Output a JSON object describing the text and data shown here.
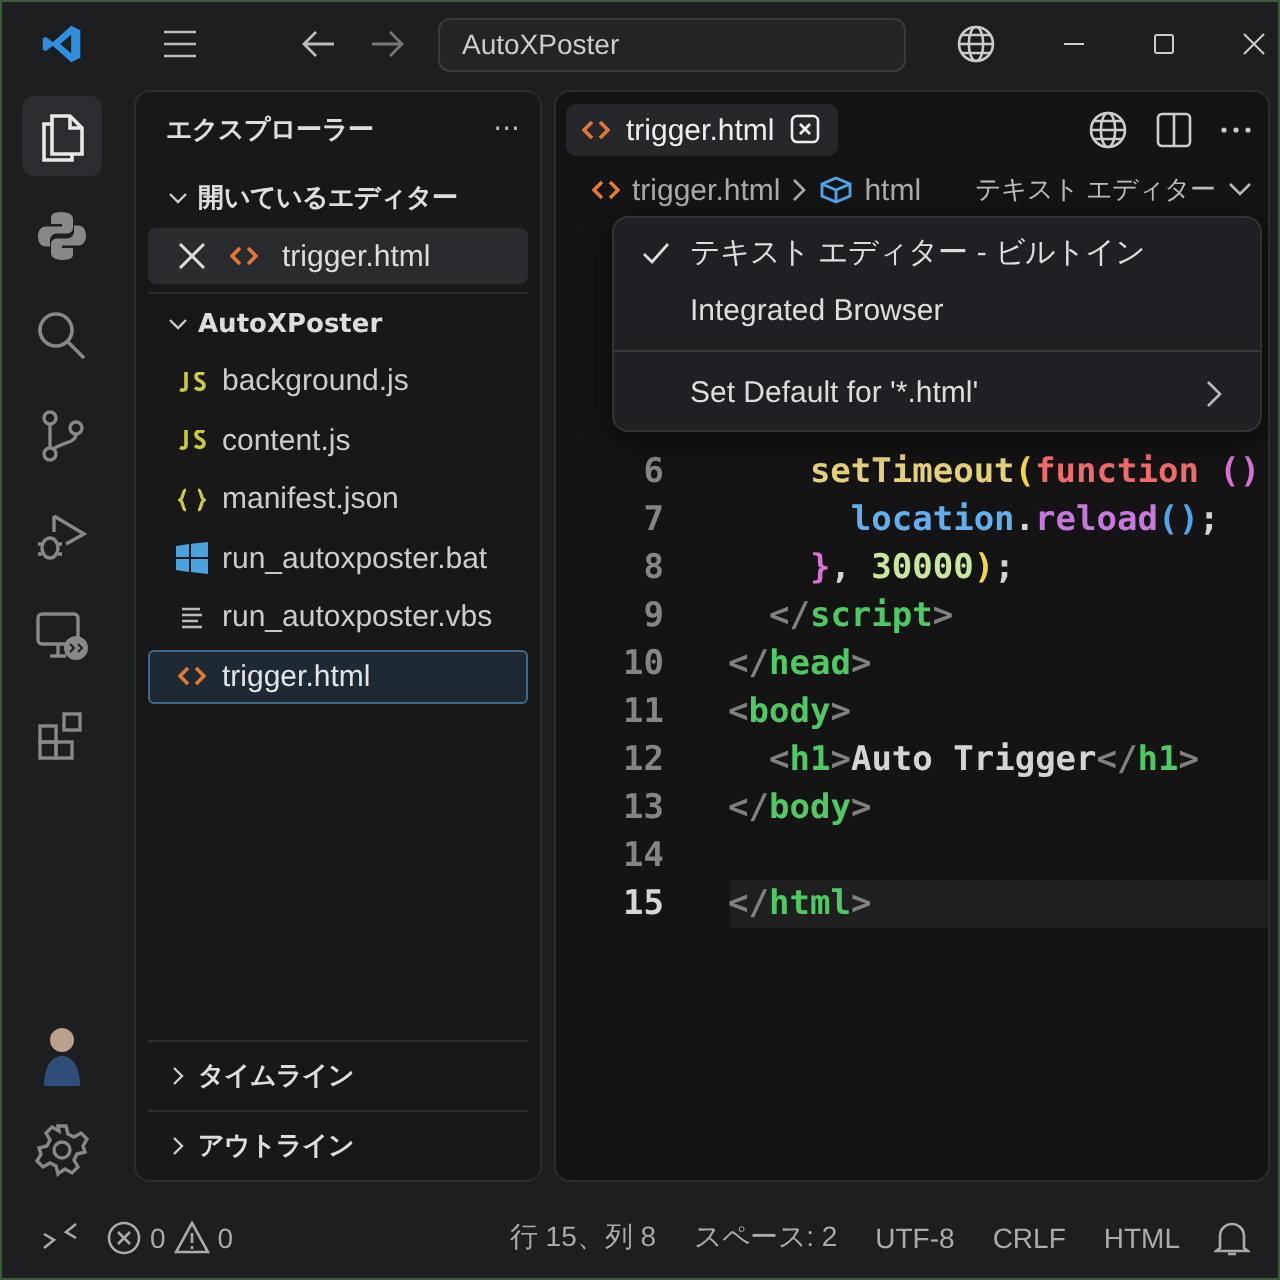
{
  "title_bar": {
    "search": {
      "value": "AutoXPoster"
    }
  },
  "activity_bar": {
    "items": [
      {
        "kind": "files",
        "selected": true
      },
      {
        "kind": "python",
        "selected": false
      },
      {
        "kind": "search",
        "selected": false
      },
      {
        "kind": "branch",
        "selected": false
      },
      {
        "kind": "debug",
        "selected": false
      },
      {
        "kind": "remote",
        "selected": false
      },
      {
        "kind": "extensions",
        "selected": false
      }
    ]
  },
  "sidebar": {
    "title": "エクスプローラー",
    "more": "···",
    "open_editors": {
      "title": "開いているエディター",
      "expanded": true,
      "items": [
        {
          "name": "trigger.html",
          "kind": "html",
          "selected": true
        }
      ]
    },
    "folder": {
      "title": "AutoXPoster",
      "expanded": true,
      "items": [
        {
          "name": "background.js",
          "kind": "js",
          "selected": false
        },
        {
          "name": "content.js",
          "kind": "js",
          "selected": false
        },
        {
          "name": "manifest.json",
          "kind": "json",
          "selected": false
        },
        {
          "name": "run_autoxposter.bat",
          "kind": "bat",
          "selected": false
        },
        {
          "name": "run_autoxposter.vbs",
          "kind": "vbs",
          "selected": false
        },
        {
          "name": "trigger.html",
          "kind": "html",
          "selected": true
        }
      ]
    },
    "sections": [
      {
        "title": "タイムライン",
        "expanded": false
      },
      {
        "title": "アウトライン",
        "expanded": false
      }
    ]
  },
  "editor": {
    "tabs": [
      {
        "name": "trigger.html",
        "kind": "html",
        "selected": true
      }
    ],
    "breadcrumb": [
      {
        "text": "trigger.html",
        "kind": "file"
      },
      {
        "text": "html",
        "kind": "element"
      }
    ],
    "editor_picker": "テキスト エディター",
    "menu": [
      {
        "label": "テキスト エディター - ビルトイン",
        "kind": "option",
        "checked": true
      },
      {
        "label": "Integrated Browser",
        "kind": "option",
        "checked": false
      },
      {
        "label": "Set Default for '*.html'",
        "kind": "submenu",
        "checked": false
      }
    ],
    "lines": [
      {
        "number": "6",
        "current": false,
        "tokens": [
          {
            "t": "    setTimeout",
            "kind": "func"
          },
          {
            "t": "(",
            "kind": "paren"
          },
          {
            "t": "function ",
            "kind": "keyword"
          },
          {
            "t": "()",
            "kind": "paren2"
          }
        ]
      },
      {
        "number": "7",
        "current": false,
        "tokens": [
          {
            "t": "      location",
            "kind": "var"
          },
          {
            "t": ".",
            "kind": "plain"
          },
          {
            "t": "reload",
            "kind": "method"
          },
          {
            "t": "()",
            "kind": "paren3"
          },
          {
            "t": ";",
            "kind": "plain"
          }
        ]
      },
      {
        "number": "8",
        "current": false,
        "tokens": [
          {
            "t": "    }",
            "kind": "paren2"
          },
          {
            "t": ", ",
            "kind": "plain"
          },
          {
            "t": "30000",
            "kind": "number"
          },
          {
            "t": ")",
            "kind": "paren"
          },
          {
            "t": ";",
            "kind": "plain"
          }
        ]
      },
      {
        "number": "9",
        "current": false,
        "tokens": [
          {
            "t": "  </",
            "kind": "bracket"
          },
          {
            "t": "script",
            "kind": "tag"
          },
          {
            "t": ">",
            "kind": "bracket"
          }
        ]
      },
      {
        "number": "10",
        "current": false,
        "tokens": [
          {
            "t": "</",
            "kind": "bracket"
          },
          {
            "t": "head",
            "kind": "tag"
          },
          {
            "t": ">",
            "kind": "bracket"
          }
        ]
      },
      {
        "number": "11",
        "current": false,
        "tokens": [
          {
            "t": "<",
            "kind": "bracket"
          },
          {
            "t": "body",
            "kind": "tag"
          },
          {
            "t": ">",
            "kind": "bracket"
          }
        ]
      },
      {
        "number": "12",
        "current": false,
        "tokens": [
          {
            "t": "  <",
            "kind": "bracket"
          },
          {
            "t": "h1",
            "kind": "tag"
          },
          {
            "t": ">",
            "kind": "bracket"
          },
          {
            "t": "Auto Trigger",
            "kind": "plain"
          },
          {
            "t": "</",
            "kind": "bracket"
          },
          {
            "t": "h1",
            "kind": "tag"
          },
          {
            "t": ">",
            "kind": "bracket"
          }
        ]
      },
      {
        "number": "13",
        "current": false,
        "tokens": [
          {
            "t": "</",
            "kind": "bracket"
          },
          {
            "t": "body",
            "kind": "tag"
          },
          {
            "t": ">",
            "kind": "bracket"
          }
        ]
      },
      {
        "number": "14",
        "current": false
      },
      {
        "number": "15",
        "current": true,
        "tokens": [
          {
            "t": "</",
            "kind": "bracket"
          },
          {
            "t": "html",
            "kind": "tag"
          },
          {
            "t": ">",
            "kind": "bracket"
          }
        ]
      }
    ]
  },
  "status_bar": {
    "errors": "0",
    "warnings": "0",
    "items": [
      "行 15、列 8",
      "スペース: 2",
      "UTF-8",
      "CRLF",
      "HTML"
    ]
  }
}
